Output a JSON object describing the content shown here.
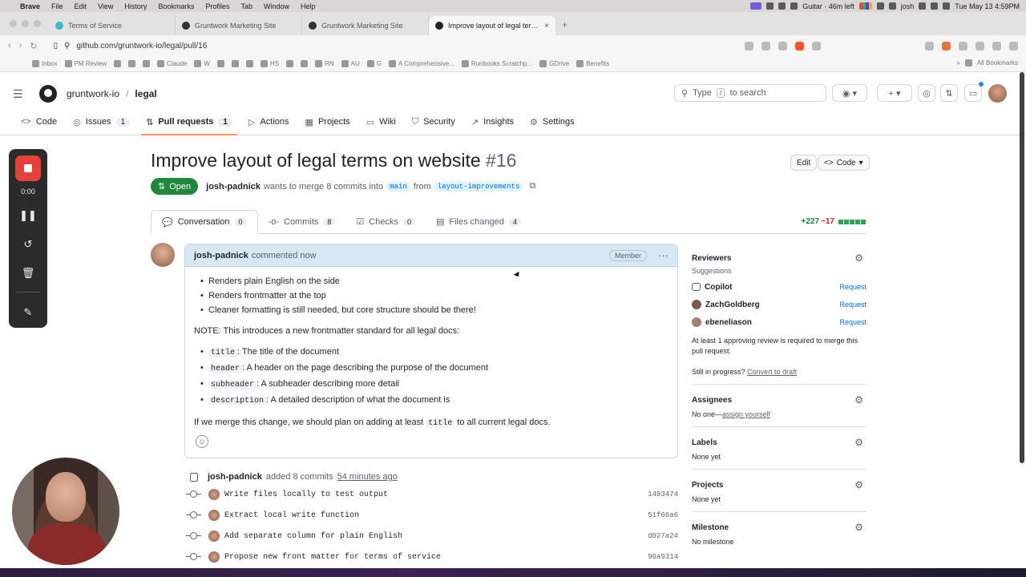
{
  "menubar": {
    "app": "Brave",
    "items": [
      "File",
      "Edit",
      "View",
      "History",
      "Bookmarks",
      "Profiles",
      "Tab",
      "Window",
      "Help"
    ],
    "timer": "Guitar · 46m left",
    "user": "josh",
    "datetime": "Tue May 13  4:59PM"
  },
  "tabs": [
    {
      "label": "Terms of Service",
      "color": "#3fb8c9"
    },
    {
      "label": "Gruntwork Marketing Site",
      "color": "#333333"
    },
    {
      "label": "Gruntwork Marketing Site",
      "color": "#333333"
    },
    {
      "label": "Improve layout of legal terms",
      "color": "#1f2328"
    }
  ],
  "address": {
    "url": "github.com/gruntwork-io/legal/pull/16"
  },
  "bookmarks": {
    "items": [
      "Inbox",
      "PM Review",
      "Claude",
      "W",
      "HS",
      "RN",
      "AU",
      "G",
      "A Comprehensive...",
      "Runbooks Scratchp...",
      "GDrive",
      "Benefits"
    ],
    "all": "All Bookmarks"
  },
  "header": {
    "owner": "gruntwork-io",
    "repo": "legal",
    "search_prefix": "Type",
    "search_key": "/",
    "search_suffix": "to search"
  },
  "repo_nav": [
    {
      "label": "Code",
      "icon": "<>"
    },
    {
      "label": "Issues",
      "count": "1",
      "icon": "◎"
    },
    {
      "label": "Pull requests",
      "count": "1",
      "icon": "⇅"
    },
    {
      "label": "Actions",
      "icon": "▷"
    },
    {
      "label": "Projects",
      "icon": "▦"
    },
    {
      "label": "Wiki",
      "icon": "▭"
    },
    {
      "label": "Security",
      "icon": "⛉"
    },
    {
      "label": "Insights",
      "icon": "↗"
    },
    {
      "label": "Settings",
      "icon": "⚙"
    }
  ],
  "recorder": {
    "time": "0:00"
  },
  "pr": {
    "title": "Improve layout of legal terms on website",
    "number": "#16",
    "state": "Open",
    "edit": "Edit",
    "code": "Code",
    "author": "josh-padnick",
    "meta1": "wants to merge 8 commits into",
    "base": "main",
    "meta2": "from",
    "head": "layout-improvements"
  },
  "pr_tabs": [
    {
      "label": "Conversation",
      "count": "0"
    },
    {
      "label": "Commits",
      "count": "8"
    },
    {
      "label": "Checks",
      "count": "0"
    },
    {
      "label": "Files changed",
      "count": "4"
    }
  ],
  "diffstat": {
    "add": "+227",
    "del": "−17"
  },
  "comment": {
    "author": "josh-padnick",
    "action": "commented now",
    "badge": "Member",
    "bullets": [
      "Renders plain English on the side",
      "Renders frontmatter at the top",
      "Cleaner formatting is still needed, but core structure should be there!"
    ],
    "note": "NOTE: This introduces a new frontmatter standard for all legal docs:",
    "fields": [
      {
        "code": "title",
        "text": ": The title of the document"
      },
      {
        "code": "header",
        "text": ": A header on the page describing the purpose of the document"
      },
      {
        "code": "subheader",
        "text": ": A subheader describing more detail"
      },
      {
        "code": "description",
        "text": ": A detailed description of what the document is"
      }
    ],
    "closing_pre": "If we merge this change, we should plan on adding at least",
    "closing_code": "title",
    "closing_post": "to all current legal docs."
  },
  "timeline": {
    "author": "josh-padnick",
    "action": "added 8 commits",
    "when": "54 minutes ago",
    "commits": [
      {
        "msg": "Write files locally to test output",
        "sha": "1483474"
      },
      {
        "msg": "Extract local write function",
        "sha": "51f66a6"
      },
      {
        "msg": "Add separate column for plain English",
        "sha": "d027a24"
      },
      {
        "msg": "Propose new front matter for terms of service",
        "sha": "90a9314"
      }
    ]
  },
  "sidebar": {
    "reviewers_title": "Reviewers",
    "suggestions": "Suggestions",
    "reviewers": [
      {
        "name": "Copilot",
        "action": "Request"
      },
      {
        "name": "ZachGoldberg",
        "action": "Request"
      },
      {
        "name": "ebeneliason",
        "action": "Request"
      }
    ],
    "approval_note": "At least 1 approving review is required to merge this pull request.",
    "in_progress": "Still in progress?",
    "convert": "Convert to draft",
    "assignees_title": "Assignees",
    "assignees_value": "No one—",
    "assign_self": "assign yourself",
    "labels_title": "Labels",
    "labels_value": "None yet",
    "projects_title": "Projects",
    "projects_value": "None yet",
    "milestone_title": "Milestone",
    "milestone_value": "No milestone"
  }
}
